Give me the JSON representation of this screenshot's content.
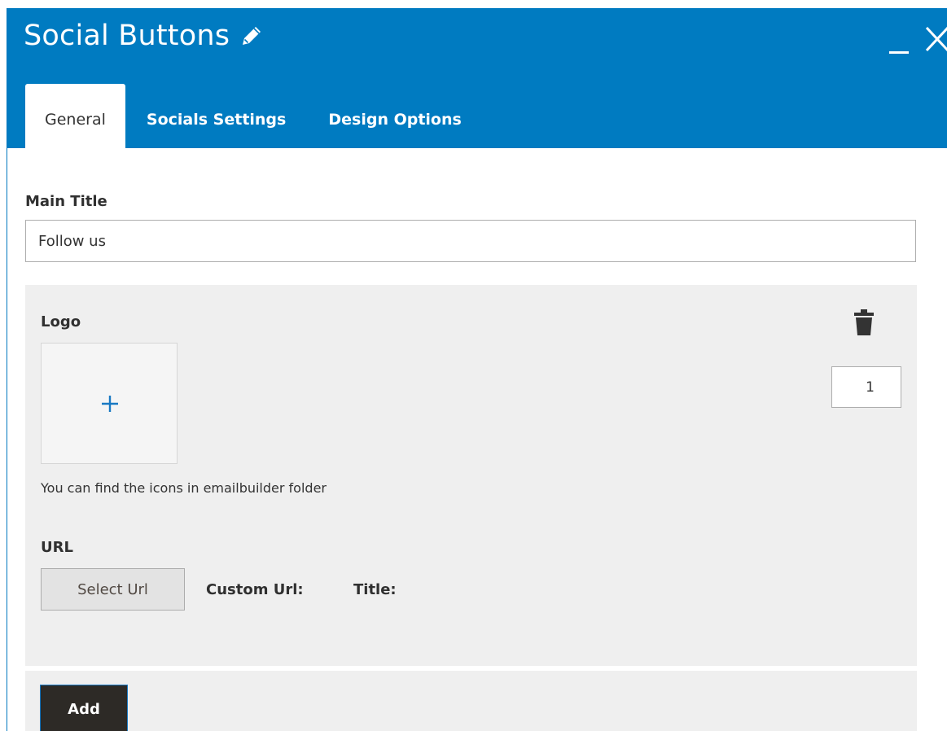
{
  "modal": {
    "title": "Social Buttons",
    "colors": {
      "header": "#007bc1",
      "panel": "#efefef",
      "add_button": "#2d2a26",
      "plus_icon": "#1979c3"
    }
  },
  "tabs": [
    {
      "label": "General",
      "active": true
    },
    {
      "label": "Socials Settings",
      "active": false
    },
    {
      "label": "Design Options",
      "active": false
    }
  ],
  "general": {
    "main_title_label": "Main Title",
    "main_title_value": "Follow us",
    "item": {
      "logo_label": "Logo",
      "hint": "You can find the icons in emailbuilder folder",
      "order_value": "1",
      "url_label": "URL",
      "select_url_label": "Select Url",
      "custom_url_label": "Custom Url:",
      "title_label": "Title:"
    },
    "add_label": "Add"
  }
}
